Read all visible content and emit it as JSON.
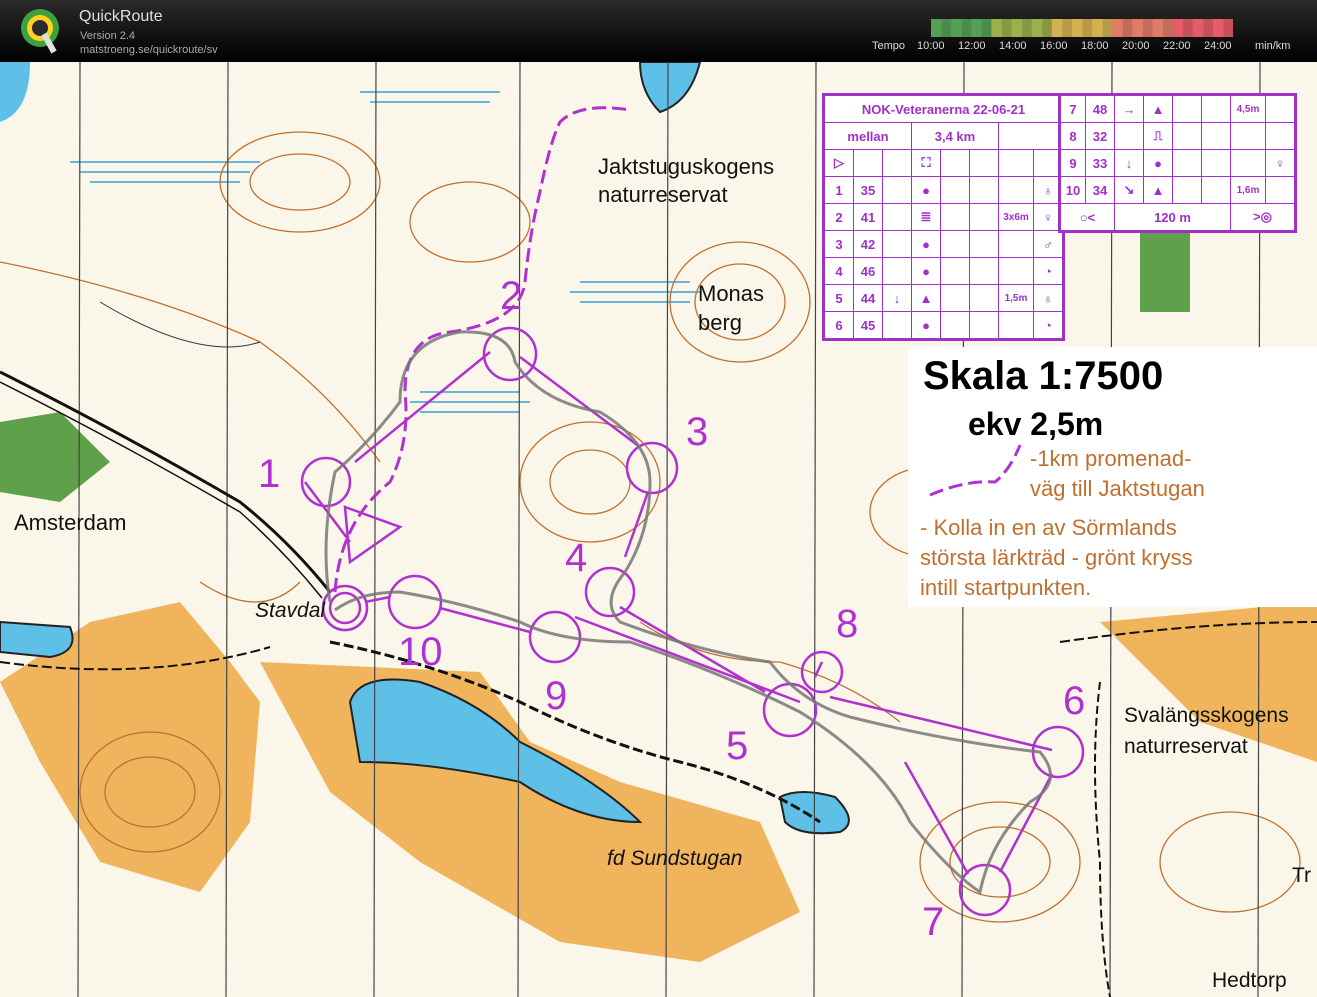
{
  "app": {
    "title": "QuickRoute",
    "version": "Version 2.4",
    "url": "matstroeng.se/quickroute/sv"
  },
  "tempo": {
    "label": "Tempo",
    "ticks": [
      "10:00",
      "12:00",
      "14:00",
      "16:00",
      "18:00",
      "20:00",
      "22:00",
      "24:00"
    ],
    "unit": "min/km",
    "colors": [
      "#55a055",
      "#9ab04a",
      "#d4b050",
      "#e07b66",
      "#e65a6a"
    ]
  },
  "map": {
    "place_names": {
      "jaktstugu1": "Jaktstuguskogens",
      "jaktstugu2": "naturreservat",
      "monas1": "Monas",
      "monas2": "berg",
      "amsterdam": "Amsterdam",
      "stavdal": "Stavdal",
      "svalang1": "Svalängsskogens",
      "svalang2": "naturreservat",
      "sundstugan": "fd Sundstugan",
      "hedtorp": "Hedtorp",
      "tr": "Tr"
    },
    "controls": [
      "1",
      "2",
      "3",
      "4",
      "5",
      "6",
      "7",
      "8",
      "9",
      "10"
    ],
    "colors": {
      "course": "#b030d0",
      "route": "#666666",
      "water": "#5ec0e6",
      "open": "#f0b45c",
      "contour": "#c0702e"
    }
  },
  "description": {
    "event": "NOK-Veteranerna 22-06-21",
    "class": "mellan",
    "length": "3,4 km",
    "start_symbol": "▷",
    "start_feature": "⛶",
    "rows": [
      {
        "n": "1",
        "code": "35",
        "dir": "",
        "feature": "●",
        "dim": "",
        "loc": "♁"
      },
      {
        "n": "2",
        "code": "41",
        "dir": "",
        "feature": "≣",
        "dim": "3x6m",
        "loc": "♀"
      },
      {
        "n": "3",
        "code": "42",
        "dir": "",
        "feature": "●",
        "dim": "",
        "loc": "♂"
      },
      {
        "n": "4",
        "code": "46",
        "dir": "",
        "feature": "●",
        "dim": "",
        "loc": "◔"
      },
      {
        "n": "5",
        "code": "44",
        "dir": "↓",
        "feature": "▲",
        "dim": "1,5m",
        "loc": "♁"
      },
      {
        "n": "6",
        "code": "45",
        "dir": "",
        "feature": "●",
        "dim": "",
        "loc": "◔"
      },
      {
        "n": "7",
        "code": "48",
        "dir": "→",
        "feature": "▲",
        "dim": "4,5m",
        "loc": ""
      },
      {
        "n": "8",
        "code": "32",
        "dir": "",
        "feature": "⎍",
        "dim": "",
        "loc": ""
      },
      {
        "n": "9",
        "code": "33",
        "dir": "↓",
        "feature": "●",
        "dim": "",
        "loc": "♀"
      },
      {
        "n": "10",
        "code": "34",
        "dir": "↘",
        "feature": "▲",
        "dim": "1,6m",
        "loc": ""
      }
    ],
    "finish": "120 m",
    "finish_left": "○<",
    "finish_right": ">◎"
  },
  "legend": {
    "scale": "Skala 1:7500",
    "ekv": "ekv 2,5m",
    "path_note_1": "-1km promenad-",
    "path_note_2": "väg till Jaktstugan",
    "tree_note_1": "- Kolla in en av Sörmlands",
    "tree_note_2": "största lärkträd - grönt kryss",
    "tree_note_3": "intill startpunkten."
  }
}
